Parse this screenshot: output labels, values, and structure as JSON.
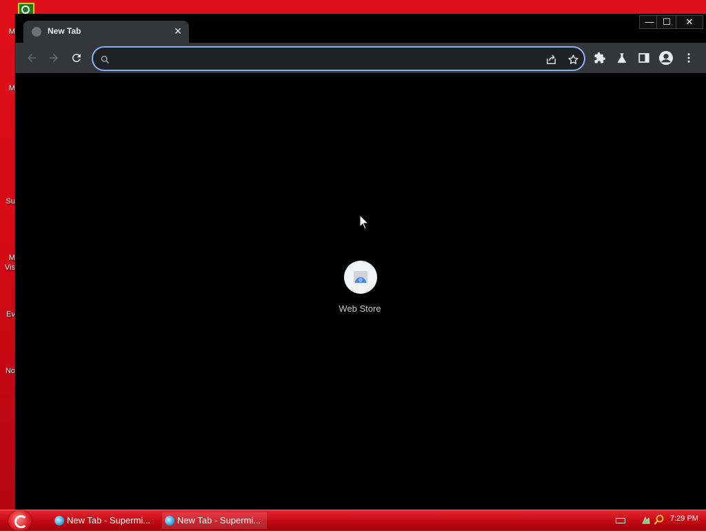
{
  "desktop": {
    "labels": [
      "M",
      "M",
      "Su",
      "M",
      "Vis",
      "Ev",
      "No"
    ]
  },
  "window": {
    "controls": {
      "minimize": "—",
      "maximize": "☐",
      "close": "✕"
    },
    "tab": {
      "title": "New Tab",
      "close": "✕"
    }
  },
  "toolbar": {
    "omnibox": {
      "value": "",
      "placeholder": ""
    }
  },
  "content": {
    "shortcut": {
      "label": "Web Store"
    }
  },
  "taskbar": {
    "tasks": [
      {
        "label": "New Tab - Supermi..."
      },
      {
        "label": "New Tab - Supermi..."
      }
    ],
    "clock": "7:29 PM"
  },
  "colors": {
    "desktop": "#d40a14",
    "toolbar": "#35363a",
    "omnibox_border": "#8ab4f8",
    "taskbar": "#c00812"
  }
}
